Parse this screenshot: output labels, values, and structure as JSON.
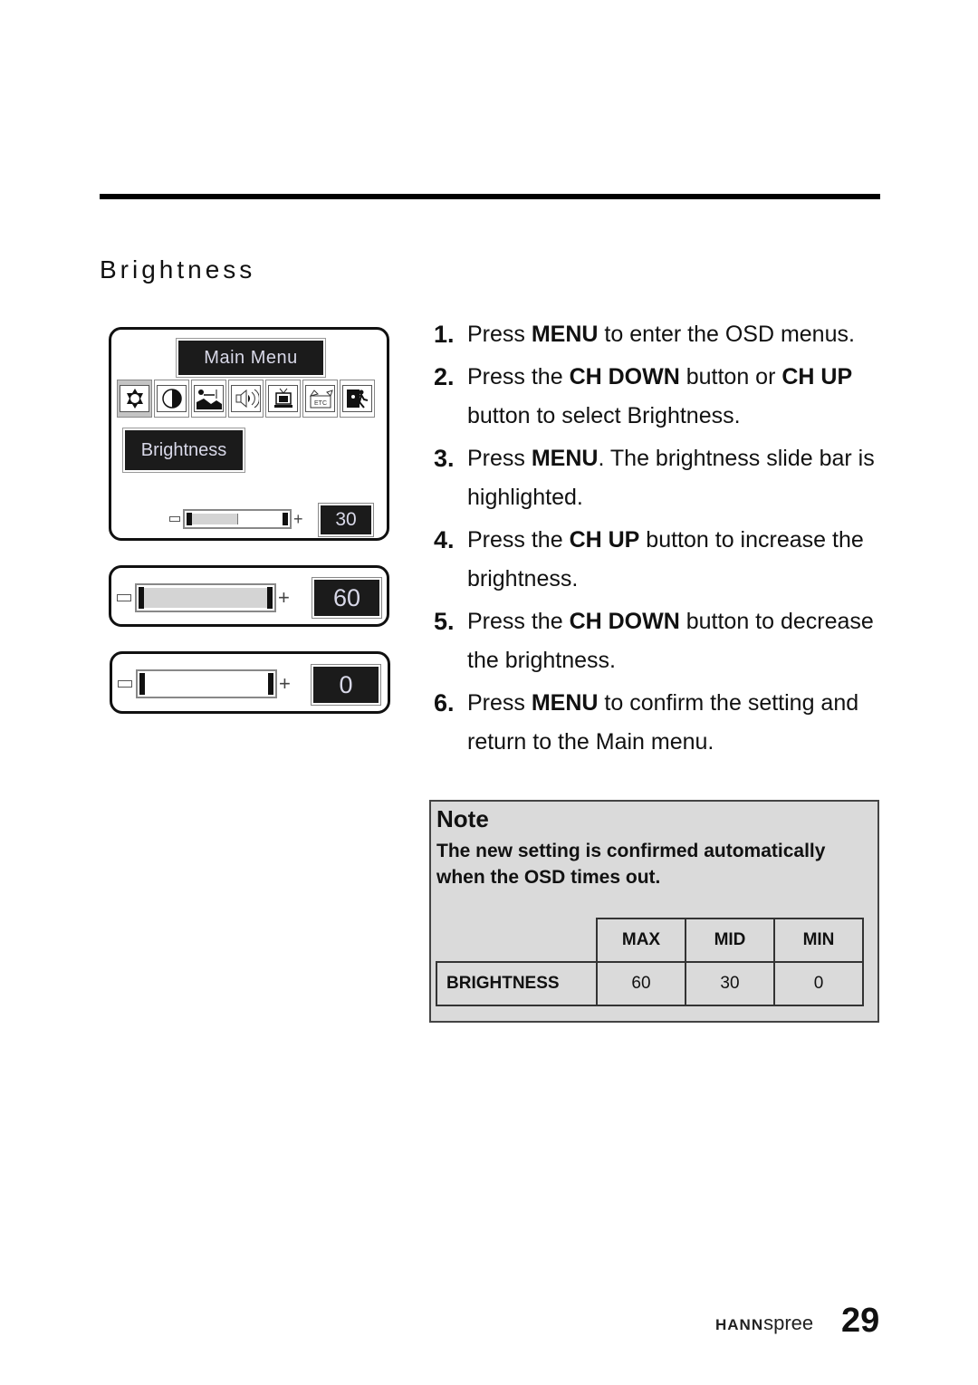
{
  "section": {
    "title": "Brightness"
  },
  "osd_main": {
    "menu_title": "Main Menu",
    "icons": [
      {
        "name": "brightness-icon",
        "selected": true
      },
      {
        "name": "contrast-icon",
        "selected": false
      },
      {
        "name": "picture-icon",
        "selected": false
      },
      {
        "name": "sound-icon",
        "selected": false
      },
      {
        "name": "tv-icon",
        "selected": false
      },
      {
        "name": "etc-icon",
        "selected": false
      },
      {
        "name": "exit-icon",
        "selected": false
      }
    ],
    "etc_label": "ETC",
    "selected_item": "Brightness",
    "slider": {
      "value": "30",
      "fraction": 0.5,
      "minus": "−",
      "plus": "+"
    }
  },
  "osd_max": {
    "slider": {
      "value": "60",
      "fraction": 1.0,
      "plus": "+"
    }
  },
  "osd_min": {
    "slider": {
      "value": "0",
      "fraction": 0.0,
      "plus": "+"
    }
  },
  "steps": [
    {
      "num": "1.",
      "parts": [
        [
          "Press ",
          false
        ],
        [
          "MENU",
          true
        ],
        [
          " to enter the OSD menus.",
          false
        ]
      ]
    },
    {
      "num": "2.",
      "parts": [
        [
          "Press the ",
          false
        ],
        [
          "CH DOWN",
          true
        ],
        [
          " button or ",
          false
        ],
        [
          "CH UP",
          true
        ],
        [
          " button to select Brightness.",
          false
        ]
      ]
    },
    {
      "num": "3.",
      "parts": [
        [
          "Press ",
          false
        ],
        [
          "MENU",
          true
        ],
        [
          ". The brightness slide bar is highlighted.",
          false
        ]
      ]
    },
    {
      "num": "4.",
      "parts": [
        [
          "Press the ",
          false
        ],
        [
          "CH UP",
          true
        ],
        [
          " button to increase the brightness.",
          false
        ]
      ]
    },
    {
      "num": "5.",
      "parts": [
        [
          "Press the ",
          false
        ],
        [
          "CH DOWN",
          true
        ],
        [
          " button to decrease the brightness.",
          false
        ]
      ]
    },
    {
      "num": "6.",
      "parts": [
        [
          "Press ",
          false
        ],
        [
          "MENU",
          true
        ],
        [
          " to confirm the setting and return to the Main menu.",
          false
        ]
      ]
    }
  ],
  "note": {
    "title": "Note",
    "text": "The new setting is confirmed automatically when the OSD times out.",
    "table": {
      "headers": [
        "MAX",
        "MID",
        "MIN"
      ],
      "rows": [
        {
          "label": "BRIGHTNESS",
          "values": [
            "60",
            "30",
            "0"
          ]
        }
      ]
    }
  },
  "footer": {
    "brand_bold": "HANN",
    "brand_light": "spree",
    "page_number": "29"
  }
}
